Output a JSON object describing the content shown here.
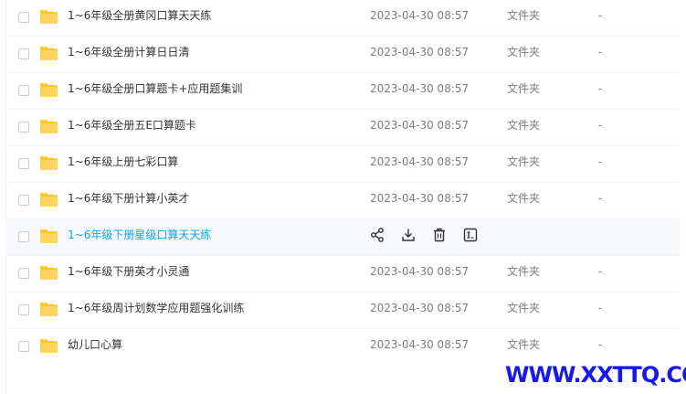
{
  "files": [
    {
      "name": "1~6年级全册黄冈口算天天练",
      "modified": "2023-04-30 08:57",
      "type": "文件夹",
      "size": "-"
    },
    {
      "name": "1~6年级全册计算日日清",
      "modified": "2023-04-30 08:57",
      "type": "文件夹",
      "size": "-"
    },
    {
      "name": "1~6年级全册口算题卡+应用题集训",
      "modified": "2023-04-30 08:57",
      "type": "文件夹",
      "size": "-"
    },
    {
      "name": "1~6年级全册五E口算题卡",
      "modified": "2023-04-30 08:57",
      "type": "文件夹",
      "size": "-"
    },
    {
      "name": "1~6年级上册七彩口算",
      "modified": "2023-04-30 08:57",
      "type": "文件夹",
      "size": "-"
    },
    {
      "name": "1~6年级下册计算小英才",
      "modified": "2023-04-30 08:57",
      "type": "文件夹",
      "size": "-"
    },
    {
      "name": "1~6年级下册星级口算天天练"
    },
    {
      "name": "1~6年级下册英才小灵通",
      "modified": "2023-04-30 08:57",
      "type": "文件夹",
      "size": "-"
    },
    {
      "name": "1~6年级周计划数学应用题强化训练",
      "modified": "2023-04-30 08:57",
      "type": "文件夹",
      "size": "-"
    },
    {
      "name": "幼儿口心算",
      "modified": "2023-04-30 08:57",
      "type": "文件夹",
      "size": "-"
    }
  ],
  "hover_actions": [
    "share-icon",
    "download-icon",
    "delete-icon",
    "rename-icon"
  ],
  "watermark": "WWW.XXTTQ.COM",
  "colors": {
    "folder": "#ffd04a",
    "hover_name": "#06a7ff",
    "hover_row_bg": "#f6f8fb",
    "watermark": "#1515ff"
  }
}
